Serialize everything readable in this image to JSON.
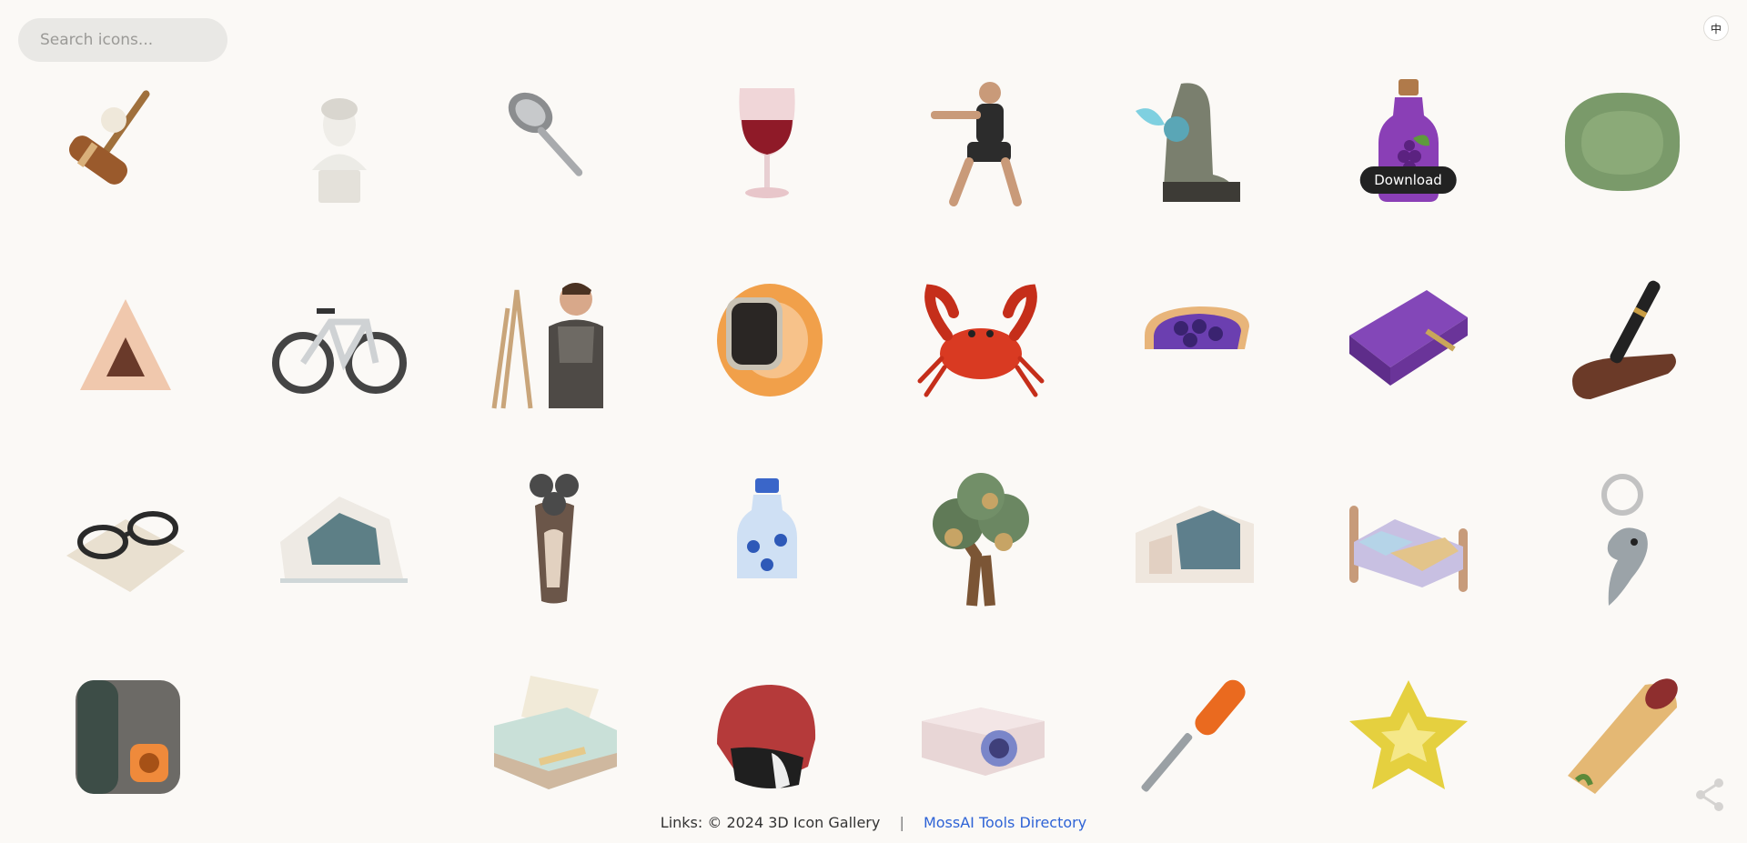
{
  "search": {
    "placeholder": "Search icons..."
  },
  "language_toggle": {
    "label": "中"
  },
  "tooltip": {
    "label": "Download"
  },
  "icons": [
    {
      "name": "croquet-mallet-icon"
    },
    {
      "name": "bust-statue-icon"
    },
    {
      "name": "spoon-icon"
    },
    {
      "name": "wine-glass-icon"
    },
    {
      "name": "martial-arts-figure-icon"
    },
    {
      "name": "rocket-boot-icon"
    },
    {
      "name": "grape-juice-bottle-icon",
      "hovered": true
    },
    {
      "name": "lotus-leaf-icon"
    },
    {
      "name": "triangle-ruler-icon"
    },
    {
      "name": "road-bike-icon"
    },
    {
      "name": "painter-at-easel-icon"
    },
    {
      "name": "smartwatch-icon"
    },
    {
      "name": "crab-icon"
    },
    {
      "name": "blueberry-pie-icon"
    },
    {
      "name": "purple-notebook-icon"
    },
    {
      "name": "fountain-pen-stand-icon"
    },
    {
      "name": "eyeglasses-on-cloth-icon"
    },
    {
      "name": "modern-building-icon"
    },
    {
      "name": "electric-shaver-icon"
    },
    {
      "name": "water-bottle-icon"
    },
    {
      "name": "money-tree-icon"
    },
    {
      "name": "glass-office-building-icon"
    },
    {
      "name": "bed-icon"
    },
    {
      "name": "dolphin-keychain-icon"
    },
    {
      "name": "portable-heater-icon"
    },
    {
      "name": "empty-slot-icon"
    },
    {
      "name": "printer-icon"
    },
    {
      "name": "helmet-icon"
    },
    {
      "name": "projector-icon"
    },
    {
      "name": "screwdriver-icon"
    },
    {
      "name": "starfruit-icon"
    },
    {
      "name": "burrito-icon"
    }
  ],
  "footer": {
    "text": "Links: © 2024 3D Icon Gallery",
    "separator": "|",
    "link": "MossAI Tools Directory"
  },
  "share": {
    "icon": "share-icon"
  }
}
